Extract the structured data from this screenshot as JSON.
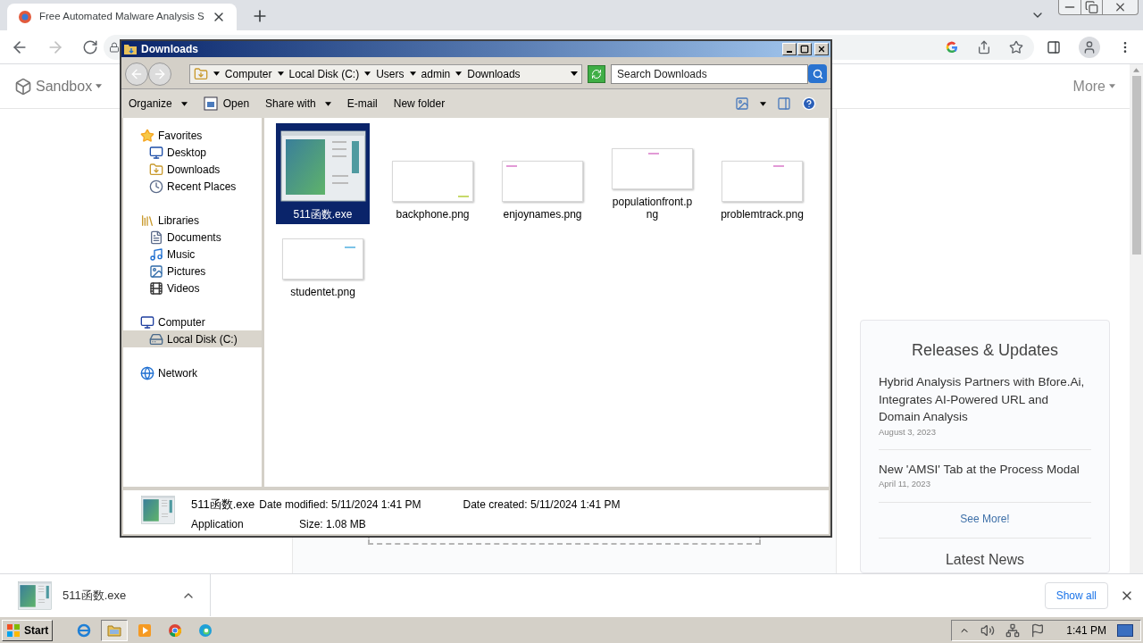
{
  "browser": {
    "tab": {
      "title": "Free Automated Malware Analysis S"
    },
    "site_nav": [
      {
        "label": "Sandbox"
      },
      {
        "label": "More"
      }
    ],
    "card": {
      "title": "Releases & Updates",
      "items": [
        {
          "title": "Hybrid Analysis Partners with Bfore.Ai, Integrates AI-Powered URL and Domain Analysis",
          "date": "August 3, 2023"
        },
        {
          "title": "New 'AMSI' Tab at the Process Modal",
          "date": "April 11, 2023"
        }
      ],
      "link": "See More!",
      "next_title": "Latest News"
    }
  },
  "explorer": {
    "title": "Downloads",
    "breadcrumb": [
      "Computer",
      "Local Disk (C:)",
      "Users",
      "admin",
      "Downloads"
    ],
    "search": {
      "placeholder": "Search Downloads"
    },
    "toolbar": [
      {
        "label": "Organize",
        "dropdown": true,
        "icon": false
      },
      {
        "label": "Open",
        "dropdown": false,
        "icon": true
      },
      {
        "label": "Share with",
        "dropdown": true,
        "icon": false
      },
      {
        "label": "E-mail",
        "dropdown": false,
        "icon": false
      },
      {
        "label": "New folder",
        "dropdown": false,
        "icon": false
      }
    ],
    "nav": [
      {
        "label": "Favorites",
        "kind": "favorites",
        "selected": false,
        "children": [
          {
            "label": "Desktop",
            "kind": "desktop",
            "selected": false
          },
          {
            "label": "Downloads",
            "kind": "downloads",
            "selected": false
          },
          {
            "label": "Recent Places",
            "kind": "recent",
            "selected": false
          }
        ]
      },
      {
        "label": "Libraries",
        "kind": "libraries",
        "selected": false,
        "children": [
          {
            "label": "Documents",
            "kind": "documents",
            "selected": false
          },
          {
            "label": "Music",
            "kind": "music",
            "selected": false
          },
          {
            "label": "Pictures",
            "kind": "pictures",
            "selected": false
          },
          {
            "label": "Videos",
            "kind": "videos",
            "selected": false
          }
        ]
      },
      {
        "label": "Computer",
        "kind": "computer",
        "selected": false,
        "children": [
          {
            "label": "Local Disk (C:)",
            "kind": "disk",
            "selected": true
          }
        ]
      },
      {
        "label": "Network",
        "kind": "network",
        "selected": false
      }
    ],
    "files": [
      {
        "name": "511函数.exe",
        "kind": "exe",
        "selected": true
      },
      {
        "name": "backphone.png",
        "kind": "png",
        "selected": false
      },
      {
        "name": "enjoynames.png",
        "kind": "png",
        "selected": false
      },
      {
        "name": "populationfront.png",
        "kind": "png",
        "selected": false
      },
      {
        "name": "problemtrack.png",
        "kind": "png",
        "selected": false
      },
      {
        "name": "studentet.png",
        "kind": "png",
        "selected": false
      }
    ],
    "details": {
      "name": "511函数.exe",
      "type": "Application",
      "modified": "Date modified: 5/11/2024 1:41 PM",
      "created": "Date created: 5/11/2024 1:41 PM",
      "size": "Size: 1.08 MB"
    }
  },
  "downloads_bar": {
    "file": "511函数.exe",
    "show_all": "Show all"
  },
  "taskbar": {
    "start": "Start",
    "apps": [
      {
        "kind": "ie",
        "selected": false
      },
      {
        "kind": "explorer",
        "selected": true
      },
      {
        "kind": "media",
        "selected": false
      },
      {
        "kind": "chrome",
        "selected": false
      },
      {
        "kind": "edge",
        "selected": false
      }
    ],
    "clock": "1:41 PM"
  }
}
